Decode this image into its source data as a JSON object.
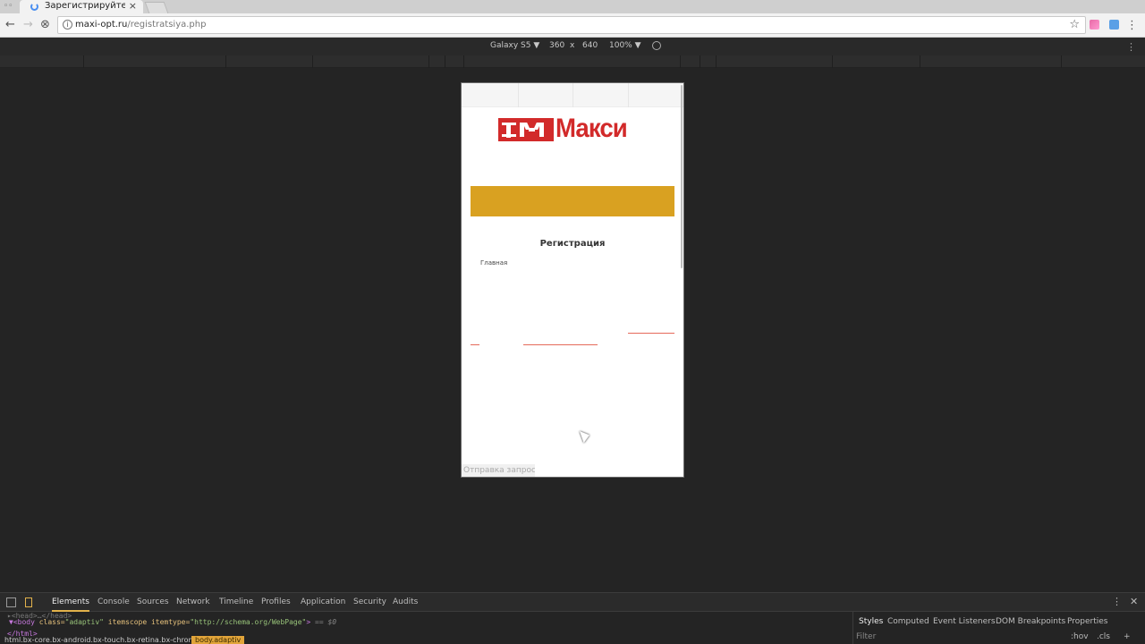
{
  "browser": {
    "tab_title": "Зарегистрируйтесь",
    "tab_close": "×",
    "url_host": "maxi-opt.ru",
    "url_path": "/registratsiya.php",
    "info_glyph": "i",
    "star_glyph": "☆",
    "back_glyph": "←",
    "forward_glyph": "→",
    "reload_glyph": "⊗",
    "menu_glyph": "⋮"
  },
  "device_toolbar": {
    "device": "Galaxy S5 ▼",
    "width": "360",
    "times": "x",
    "height": "640",
    "zoom": "100% ▼",
    "menu_glyph": "⋮"
  },
  "page": {
    "logo_text": "Макси",
    "heading": "Регистрация",
    "breadcrumb": "Главная",
    "status": "Отправка запрос"
  },
  "devtools": {
    "tabs": [
      "Elements",
      "Console",
      "Sources",
      "Network",
      "Timeline",
      "Profiles",
      "Application",
      "Security",
      "Audits"
    ],
    "head_line": "▸<head>…</head>",
    "body_open": "▼<body ",
    "attr_class": "class=",
    "attr_class_val": "\"adaptiv\"",
    "attr_itemscope": " itemscope itemtype=",
    "attr_itemtype_val": "\"http://schema.org/WebPage\"",
    "body_close_bracket": ">",
    "eq_sel": " == $0",
    "html_close": "</html>",
    "crumb_html": "html.bx-core.bx-android.bx-touch.bx-retina.bx-chrome",
    "crumb_body": "body.adaptiv",
    "menu_glyph": "⋮",
    "close_glyph": "✕",
    "side_tabs": [
      "Styles",
      "Computed",
      "Event Listeners",
      "DOM Breakpoints",
      "Properties"
    ],
    "filter_placeholder": "Filter",
    "hov": ":hov",
    "cls": ".cls",
    "plus": "+"
  },
  "colors": {
    "brand_red": "#d22a2a",
    "gold": "#d9a121",
    "devtools_accent": "#e2b24b"
  }
}
